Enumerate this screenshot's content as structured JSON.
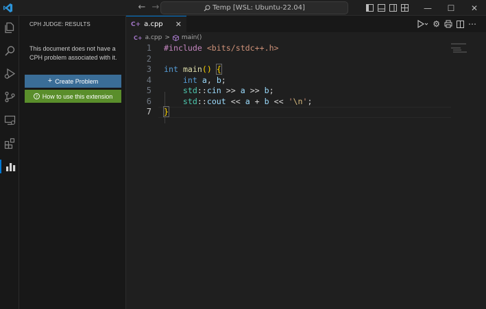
{
  "titlebar": {
    "search_text": "Temp [WSL: Ubuntu-22.04]",
    "icons": [
      "vscode-logo-icon",
      "arrow-left-icon",
      "arrow-right-icon",
      "search-icon",
      "toggle-sidebar-icon",
      "toggle-panel-icon",
      "toggle-secondary-sidebar-icon",
      "layout-icon",
      "minimize-icon",
      "maximize-icon",
      "close-icon"
    ]
  },
  "activitybar": {
    "items": [
      "explorer-icon",
      "search-icon",
      "run-debug-icon",
      "source-control-icon",
      "remote-explorer-icon",
      "extensions-icon",
      "cph-judge-icon"
    ]
  },
  "sidebar": {
    "title": "CPH JUDGE: RESULTS",
    "message": "This document does not have a CPH problem associated with it.",
    "create_button": "Create Problem",
    "help_button": "How to use this extension"
  },
  "editor": {
    "tab": {
      "label": "a.cpp",
      "close": "✕"
    },
    "breadcrumb": {
      "file": "a.cpp",
      "separator": ">",
      "symbol": "main()"
    },
    "line_numbers": [
      "1",
      "2",
      "3",
      "4",
      "5",
      "6",
      "7"
    ],
    "code": {
      "l1_directive": "#include",
      "l1_header": "<bits/stdc++.h>",
      "l3_type": "int",
      "l3_name": "main",
      "l3_parens": "()",
      "l3_open": "{",
      "l4_type": "int",
      "l4_a": "a",
      "l4_comma": ",",
      "l4_b": "b",
      "l4_semi": ";",
      "l5_ns": "std",
      "l5_sep": "::",
      "l5_obj": "cin",
      "l5_op1": ">>",
      "l5_a": "a",
      "l5_op2": ">>",
      "l5_b": "b",
      "l5_semi": ";",
      "l6_ns": "std",
      "l6_sep": "::",
      "l6_obj": "cout",
      "l6_op1": "<<",
      "l6_a": "a",
      "l6_plus": "+",
      "l6_b": "b",
      "l6_op2": "<<",
      "l6_q1": "'",
      "l6_esc": "\\n",
      "l6_q2": "'",
      "l6_semi": ";",
      "l7_close": "}"
    }
  },
  "colors": {
    "accent": "#0078d4",
    "create_button": "#3a6d97",
    "help_button": "#5a8e2b"
  }
}
